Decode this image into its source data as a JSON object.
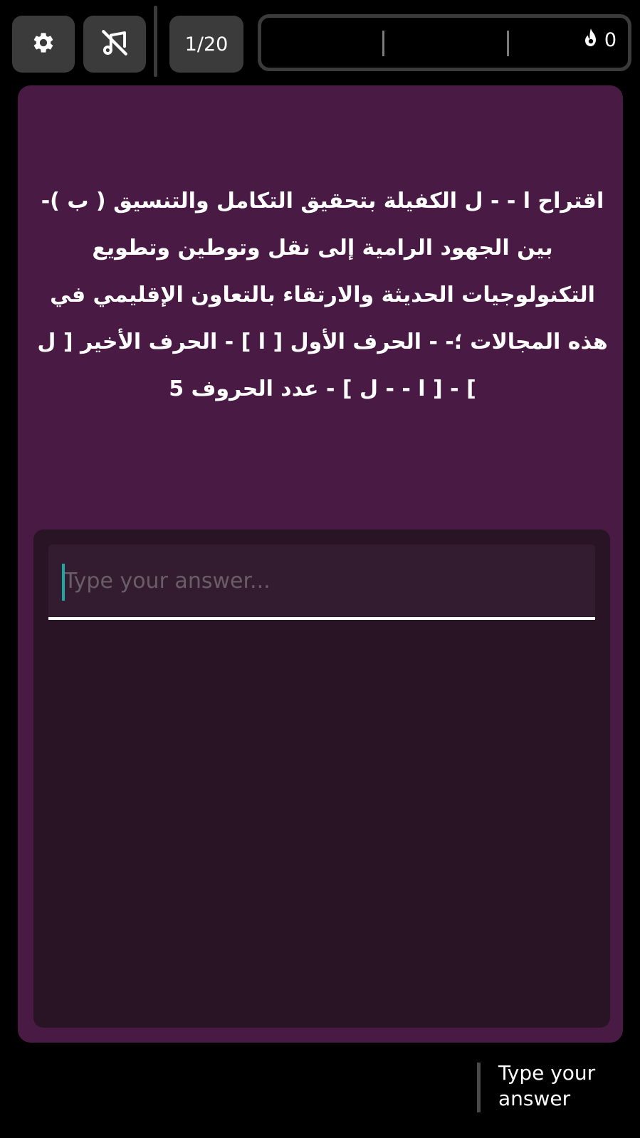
{
  "toolbar": {
    "settings_icon": "gear-icon",
    "music_icon": "music-off-icon",
    "question_counter": "1/20"
  },
  "progress": {
    "streak_icon": "flame-icon",
    "streak_count": "0"
  },
  "question": {
    "text": "اقتراح ا - - ل الكفيلة بتحقيق التكامل والتنسيق ( ب )- بين الجهود الرامية إلى نقل وتوطين وتطويع التكنولوجيات الحديثة والارتقاء بالتعاون الإقليمي في هذه المجالات ؛- - الحرف الأول [ ا ] - الحرف الأخير [ ل ] - [ ا - - ل ] - عدد الحروف 5"
  },
  "answer": {
    "placeholder": "Type your answer...",
    "value": ""
  },
  "footer": {
    "submit_label": "Type your answer"
  },
  "colors": {
    "background": "#000000",
    "card": "#491a44",
    "panel": "#281424",
    "input": "#331c30",
    "button": "#3b3b3b",
    "caret": "#1ea7a0"
  }
}
